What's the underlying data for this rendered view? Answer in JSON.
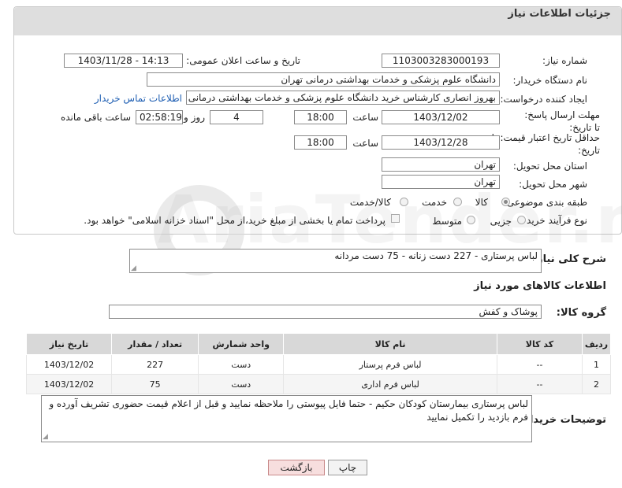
{
  "header": {
    "title": "جزئیات اطلاعات نیاز"
  },
  "form": {
    "need_number": {
      "label": "شماره نیاز:",
      "value": "1103003283000193"
    },
    "announce": {
      "label": "تاریخ و ساعت اعلان عمومی:",
      "value": "1403/11/28 - 14:13"
    },
    "buyer_org": {
      "label": "نام دستگاه خریدار:",
      "value": "دانشگاه علوم پزشکی و خدمات بهداشتی درمانی تهران"
    },
    "requester": {
      "label": "ایجاد کننده درخواست:",
      "value": "بهروز انصاری کارشناس خرید دانشگاه علوم پزشکی و خدمات بهداشتی درمانی",
      "link": "اطلاعات تماس خریدار"
    },
    "deadline": {
      "label": "مهلت ارسال پاسخ: تا تاریخ:",
      "date": "1403/12/02",
      "time_label": "ساعت",
      "time": "18:00",
      "days": "4",
      "days_label": "روز و",
      "remaining": "02:58:19",
      "remaining_label": "ساعت باقی مانده"
    },
    "validity": {
      "label": "حداقل تاریخ اعتبار قیمت: تا تاریخ:",
      "date": "1403/12/28",
      "time_label": "ساعت",
      "time": "18:00"
    },
    "province": {
      "label": "استان محل تحویل:",
      "value": "تهران"
    },
    "city": {
      "label": "شهر محل تحویل:",
      "value": "تهران"
    },
    "category": {
      "label": "طبقه بندی موضوعی:",
      "options": [
        "کالا",
        "خدمت",
        "کالا/خدمت"
      ],
      "selected": "کالا"
    },
    "process": {
      "label": "نوع فرآیند خرید :",
      "options": [
        "جزیی",
        "متوسط"
      ],
      "note": "پرداخت تمام یا بخشی از مبلغ خرید،از محل \"اسناد خزانه اسلامی\" خواهد بود."
    }
  },
  "description": {
    "label": "شرح کلی نیاز:",
    "value": "لباس پرستاری - 227 دست زنانه - 75 دست مردانه"
  },
  "goods_section": {
    "title": "اطلاعات کالاهای مورد نیاز"
  },
  "goods_group": {
    "label": "گروه کالا:",
    "value": "پوشاک و کفش"
  },
  "table": {
    "headers": [
      "ردیف",
      "کد کالا",
      "نام کالا",
      "واحد شمارش",
      "تعداد / مقدار",
      "تاریخ نیاز"
    ],
    "rows": [
      [
        "1",
        "--",
        "لباس فرم پرستار",
        "دست",
        "227",
        "1403/12/02"
      ],
      [
        "2",
        "--",
        "لباس فرم اداری",
        "دست",
        "75",
        "1403/12/02"
      ]
    ]
  },
  "buyer_notes": {
    "label": "توضیحات خریدار:",
    "value": "لباس پرستاری بیمارستان کودکان حکیم - حتما فایل پیوستی را ملاحظه نمایید و قبل از اعلام قیمت حضوری تشریف آورده و فرم بازدید را تکمیل نمایید"
  },
  "buttons": {
    "print": "چاپ",
    "back": "بازگشت"
  },
  "watermark": "AriaTender.neT"
}
